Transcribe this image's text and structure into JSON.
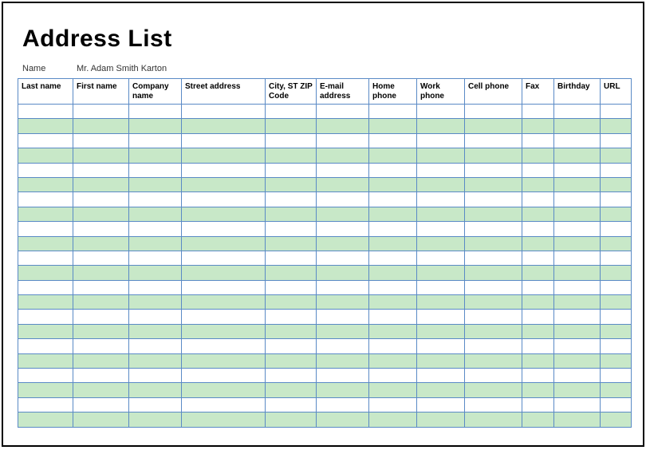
{
  "title": "Address List",
  "name_field": {
    "label": "Name",
    "value": "Mr. Adam Smith Karton"
  },
  "chart_data": {
    "type": "table",
    "columns": [
      "Last name",
      "First name",
      "Company name",
      "Street address",
      "City, ST  ZIP Code",
      "E-mail address",
      "Home phone",
      "Work phone",
      "Cell phone",
      "Fax",
      "Birthday",
      "URL"
    ],
    "rows": [
      [
        "",
        "",
        "",
        "",
        "",
        "",
        "",
        "",
        "",
        "",
        "",
        ""
      ],
      [
        "",
        "",
        "",
        "",
        "",
        "",
        "",
        "",
        "",
        "",
        "",
        ""
      ],
      [
        "",
        "",
        "",
        "",
        "",
        "",
        "",
        "",
        "",
        "",
        "",
        ""
      ],
      [
        "",
        "",
        "",
        "",
        "",
        "",
        "",
        "",
        "",
        "",
        "",
        ""
      ],
      [
        "",
        "",
        "",
        "",
        "",
        "",
        "",
        "",
        "",
        "",
        "",
        ""
      ],
      [
        "",
        "",
        "",
        "",
        "",
        "",
        "",
        "",
        "",
        "",
        "",
        ""
      ],
      [
        "",
        "",
        "",
        "",
        "",
        "",
        "",
        "",
        "",
        "",
        "",
        ""
      ],
      [
        "",
        "",
        "",
        "",
        "",
        "",
        "",
        "",
        "",
        "",
        "",
        ""
      ],
      [
        "",
        "",
        "",
        "",
        "",
        "",
        "",
        "",
        "",
        "",
        "",
        ""
      ],
      [
        "",
        "",
        "",
        "",
        "",
        "",
        "",
        "",
        "",
        "",
        "",
        ""
      ],
      [
        "",
        "",
        "",
        "",
        "",
        "",
        "",
        "",
        "",
        "",
        "",
        ""
      ],
      [
        "",
        "",
        "",
        "",
        "",
        "",
        "",
        "",
        "",
        "",
        "",
        ""
      ],
      [
        "",
        "",
        "",
        "",
        "",
        "",
        "",
        "",
        "",
        "",
        "",
        ""
      ],
      [
        "",
        "",
        "",
        "",
        "",
        "",
        "",
        "",
        "",
        "",
        "",
        ""
      ],
      [
        "",
        "",
        "",
        "",
        "",
        "",
        "",
        "",
        "",
        "",
        "",
        ""
      ],
      [
        "",
        "",
        "",
        "",
        "",
        "",
        "",
        "",
        "",
        "",
        "",
        ""
      ],
      [
        "",
        "",
        "",
        "",
        "",
        "",
        "",
        "",
        "",
        "",
        "",
        ""
      ],
      [
        "",
        "",
        "",
        "",
        "",
        "",
        "",
        "",
        "",
        "",
        "",
        ""
      ],
      [
        "",
        "",
        "",
        "",
        "",
        "",
        "",
        "",
        "",
        "",
        "",
        ""
      ],
      [
        "",
        "",
        "",
        "",
        "",
        "",
        "",
        "",
        "",
        "",
        "",
        ""
      ],
      [
        "",
        "",
        "",
        "",
        "",
        "",
        "",
        "",
        "",
        "",
        "",
        ""
      ],
      [
        "",
        "",
        "",
        "",
        "",
        "",
        "",
        "",
        "",
        "",
        "",
        ""
      ]
    ]
  }
}
